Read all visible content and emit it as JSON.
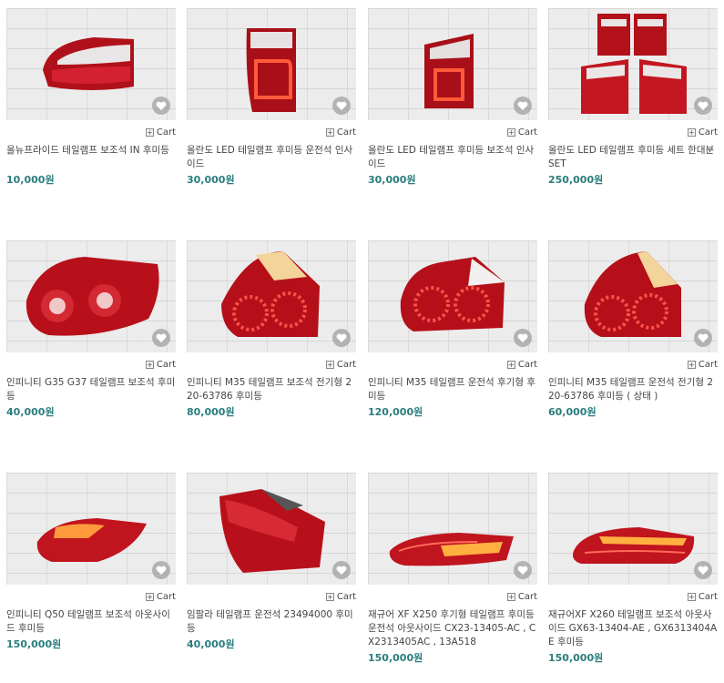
{
  "cart_label": "Cart",
  "products": [
    {
      "name": "올뉴프라이드 테일램프 보조석 IN 후미등",
      "price": "10,000원"
    },
    {
      "name": "올란도 LED 테일램프 후미등 운전석 인사이드",
      "price": "30,000원"
    },
    {
      "name": "올란도 LED 테일램프 후미등 보조석 인사이드",
      "price": "30,000원"
    },
    {
      "name": "올란도 LED 테일램프 후미등 세트 한대분 SET",
      "price": "250,000원"
    },
    {
      "name": "인피니티 G35 G37 테일램프 보조석 후미등",
      "price": "40,000원"
    },
    {
      "name": "인피니티 M35 테일램프 보조석 전기형 220-63786 후미등",
      "price": "80,000원"
    },
    {
      "name": "인피니티 M35 테일램프 운전석 후기형 후미등",
      "price": "120,000원"
    },
    {
      "name": "인피니티 M35 테일램프 운전석 전기형 220-63786 후미등 ( 상태 )",
      "price": "60,000원"
    },
    {
      "name": "인피니티 Q50 테일램프 보조석 아웃사이드 후미등",
      "price": "150,000원"
    },
    {
      "name": "임팔라 테일램프 운전석 23494000 후미등",
      "price": "40,000원"
    },
    {
      "name": "재규어 XF X250 후기형 테일램프 후미등 운전석 아웃사이드 CX23-13405-AC , CX2313405AC , 13A518",
      "price": "150,000원"
    },
    {
      "name": "재규어XF X260 테일램프 보조석 아웃사이드 GX63-13404-AE , GX6313404AE 후미등",
      "price": "150,000원"
    }
  ],
  "icons": {
    "heart": "heart-icon",
    "add": "plus-box-icon"
  },
  "colors": {
    "price": "#2a7d7d",
    "lamp_red": "#c0141e"
  }
}
